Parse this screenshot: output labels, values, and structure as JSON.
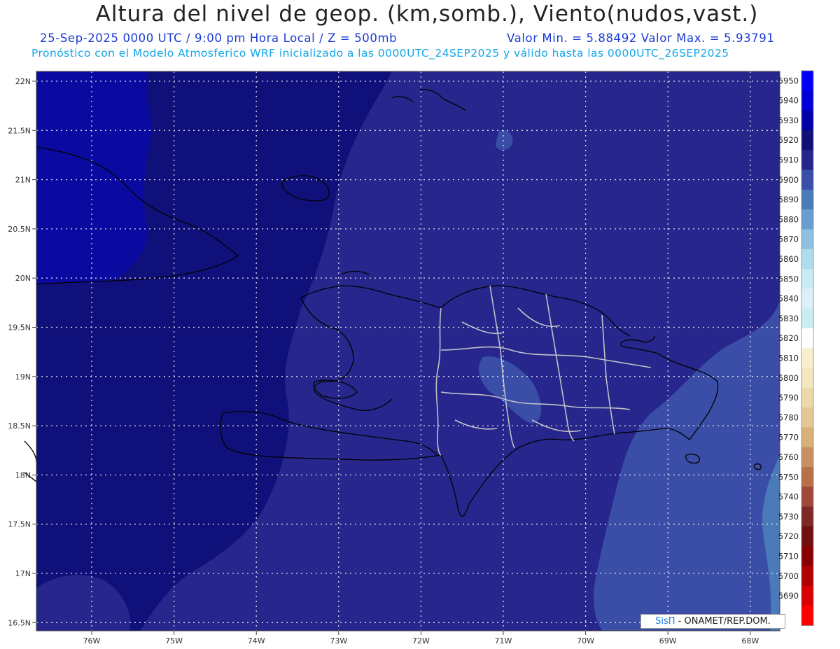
{
  "title": "Altura del nivel de geop. (km,somb.), Viento(nudos,vast.)",
  "subtitle_left": "25-Sep-2025  0000 UTC / 9:00 pm Hora Local / Z = 500mb",
  "subtitle_right": "Valor Min. = 5.88492  Valor Max. = 5.93791",
  "subtitle2": "Pronóstico con el Modelo Atmosferico WRF inicializado a las 0000UTC_24SEP2025 y válido hasta las  0000UTC_26SEP2025",
  "credit": {
    "brand": "SisΠ",
    "text": " - ONAMET/REP.DOM."
  },
  "lat_labels": [
    "22N",
    "21.5N",
    "21N",
    "20.5N",
    "20N",
    "19.5N",
    "19N",
    "18.5N",
    "18N",
    "17.5N",
    "17N",
    "16.5N"
  ],
  "lon_labels": [
    "76W",
    "75W",
    "74W",
    "73W",
    "72W",
    "71W",
    "70W",
    "69W",
    "68W"
  ],
  "colorbar": {
    "levels": [
      5950,
      5940,
      5930,
      5920,
      5910,
      5900,
      5890,
      5880,
      5870,
      5860,
      5850,
      5840,
      5830,
      5820,
      5810,
      5800,
      5790,
      5780,
      5770,
      5760,
      5750,
      5740,
      5730,
      5720,
      5710,
      5700,
      5690
    ],
    "colors": [
      "#0000f8",
      "#0000d8",
      "#0000a8",
      "#10107a",
      "#26268c",
      "#3a4ea8",
      "#4a7ab8",
      "#6a9ed0",
      "#8ec0e0",
      "#b0dcee",
      "#c8eaf4",
      "#dcf0f8",
      "#c8eef4",
      "#ffffff",
      "#f8f0cc",
      "#f4e6c0",
      "#ecd8a8",
      "#e4c894",
      "#d8b078",
      "#c89060",
      "#b87048",
      "#a04838",
      "#802828",
      "#701010",
      "#880000",
      "#b00000",
      "#d80000",
      "#ff0000"
    ]
  },
  "colors": {
    "title": "#222222",
    "sub1": "#1a3ad6",
    "sub2": "#13a6e6",
    "deep": "#10107a",
    "mid": "#26268c",
    "brand": "#1a7fe6"
  }
}
